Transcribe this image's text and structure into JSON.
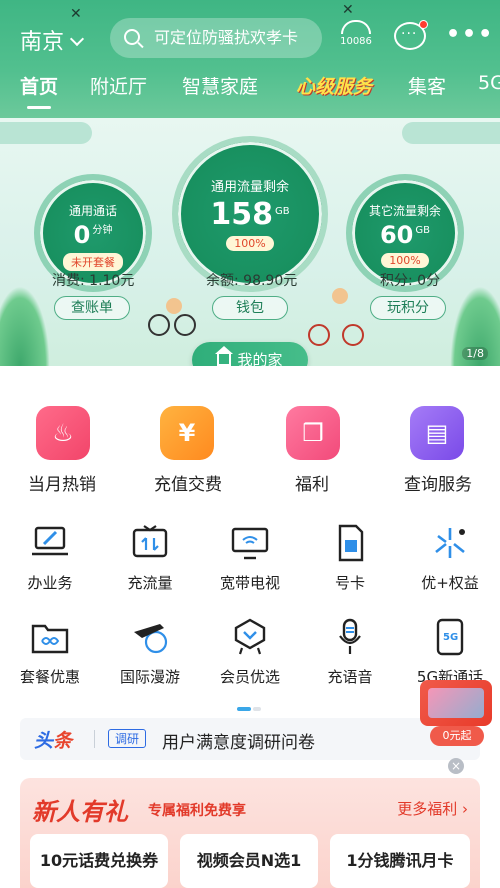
{
  "header": {
    "city": "南京",
    "search_placeholder": "可定位防骚扰欢孝卡",
    "hotline": "10086",
    "more": "•••"
  },
  "tabs": [
    {
      "label": "首页",
      "active": true
    },
    {
      "label": "附近厅"
    },
    {
      "label": "智慧家庭"
    },
    {
      "label": "心级服务"
    },
    {
      "label": "集客"
    },
    {
      "label": "5G"
    }
  ],
  "banner": {
    "gauges": [
      {
        "title": "通用通话",
        "value": "0",
        "unit": "分钟",
        "badge": "未开套餐"
      },
      {
        "title": "通用流量剩余",
        "value": "158",
        "unit": "GB",
        "badge": "100%"
      },
      {
        "title": "其它流量剩余",
        "value": "60",
        "unit": "GB",
        "badge": "100%"
      }
    ],
    "stats": [
      {
        "label": "消费: 1.10元",
        "button": "查账单"
      },
      {
        "label": "余额: 98.90元",
        "button": "钱包"
      },
      {
        "label": "积分: 0分",
        "button": "玩积分"
      }
    ],
    "pager": "1/8",
    "my_home": "我的家"
  },
  "big_services": [
    {
      "label": "当月热销",
      "color": "#f2456a",
      "icon": "flame-icon"
    },
    {
      "label": "充值交费",
      "color": "#ff9a1f",
      "icon": "yen-icon"
    },
    {
      "label": "福利",
      "color": "#f24a7a",
      "icon": "gift-icon"
    },
    {
      "label": "查询服务",
      "color": "#8a5cf0",
      "icon": "document-search-icon"
    }
  ],
  "services_row1": [
    {
      "label": "办业务",
      "icon": "laptop-pen-icon"
    },
    {
      "label": "充流量",
      "icon": "data-charge-icon"
    },
    {
      "label": "宽带电视",
      "icon": "wifi-tv-icon"
    },
    {
      "label": "号卡",
      "icon": "sim-card-icon"
    },
    {
      "label": "优+权益",
      "icon": "sparkle-icon"
    }
  ],
  "services_row2": [
    {
      "label": "套餐优惠",
      "icon": "folder-infinity-icon"
    },
    {
      "label": "国际漫游",
      "icon": "plane-globe-icon"
    },
    {
      "label": "会员优选",
      "icon": "member-badge-icon"
    },
    {
      "label": "充语音",
      "icon": "microphone-icon"
    },
    {
      "label": "5G新通话",
      "icon": "5g-phone-icon"
    }
  ],
  "headline": {
    "tag_a": "头",
    "tag_b": "条",
    "badge": "调研",
    "text": "用户满意度调研问卷"
  },
  "promo": {
    "title": "新人有礼",
    "subtitle": "专属福利免费享",
    "more": "更多福利 ›",
    "coupons": [
      "10元话费兑换券",
      "视频会员N选1",
      "1分钱腾讯月卡"
    ]
  },
  "float_gift": {
    "tag": "0元起"
  }
}
